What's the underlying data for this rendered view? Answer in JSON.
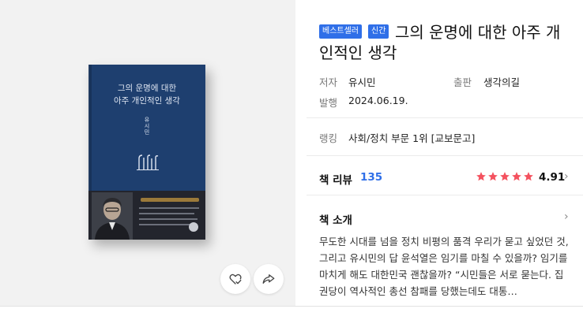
{
  "book": {
    "badges": [
      "베스트셀러",
      "신간"
    ],
    "title": "그의 운명에 대한 아주 개인적인 생각",
    "cover": {
      "title_line1": "그의 운명에 대한",
      "title_line2": "아주 개인적인 생각",
      "author": "유시민",
      "background_color": "#1e3f6f"
    },
    "meta": {
      "author_label": "저자",
      "author_value": "유시민",
      "publisher_label": "출판",
      "publisher_value": "생각의길",
      "date_label": "발행",
      "date_value": "2024.06.19.",
      "ranking_label": "랭킹",
      "ranking_value": "사회/정치 부문 1위 [교보문고]"
    },
    "reviews": {
      "label": "책 리뷰",
      "count": "135",
      "rating": "4.91",
      "stars": 5,
      "star_color": "#f4525f"
    },
    "intro": {
      "label": "책 소개",
      "text": "무도한 시대를 넘을 정치 비평의 품격 우리가 묻고 싶었던 것, 그리고 유시민의 답 윤석열은 임기를 마칠 수 있을까? 임기를 마치게 해도 대한민국 괜찮을까? “시민들은 서로 묻는다. 집권당이 역사적인 총선 참패를 당했는데도 대통…"
    }
  },
  "actions": {
    "like_icon": "heart-check-icon",
    "share_icon": "share-icon"
  },
  "colors": {
    "accent": "#2f6fe8",
    "gallery_bg": "#f2f2f2"
  }
}
